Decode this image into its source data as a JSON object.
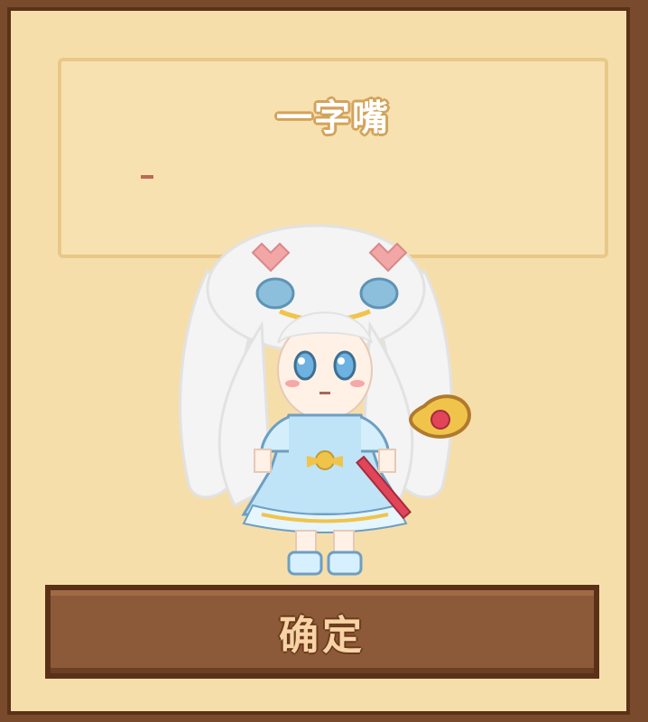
{
  "dialog": {
    "expression_name": "一字嘴",
    "confirm_label": "确定"
  },
  "character": {
    "hair_color": "#f3f3f3",
    "dress_color": "#bfe3f7",
    "accent_pink": "#f2a6a6",
    "accent_gold": "#f0c44b",
    "wand_red": "#e0455a"
  }
}
